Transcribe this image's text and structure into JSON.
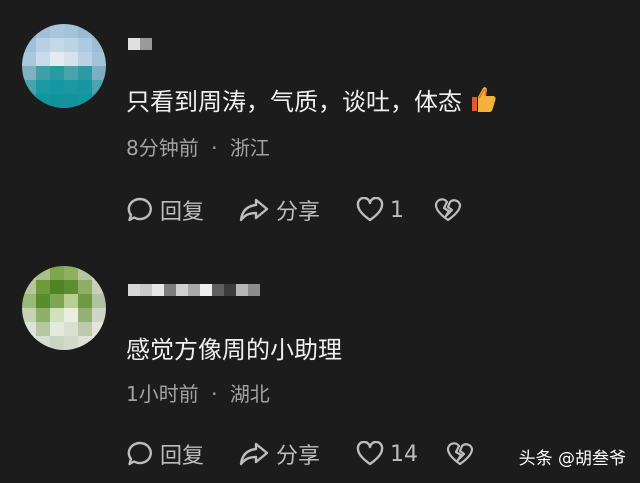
{
  "comments": [
    {
      "text": "只看到周涛，气质，谈吐，体态",
      "emoji": "thumbs-up-icon",
      "time": "8分钟前",
      "separator": "·",
      "location": "浙江",
      "reply_label": "回复",
      "share_label": "分享",
      "like_count": "1"
    },
    {
      "text": "感觉方像周的小助理",
      "time": "1小时前",
      "separator": "·",
      "location": "湖北",
      "reply_label": "回复",
      "share_label": "分享",
      "like_count": "14"
    }
  ],
  "watermark": "头条 @胡叁爷",
  "colors": {
    "background": "#1c1c1c",
    "text": "#f0f0f0",
    "meta": "#a3a3a3",
    "action": "#bdbdbd"
  }
}
